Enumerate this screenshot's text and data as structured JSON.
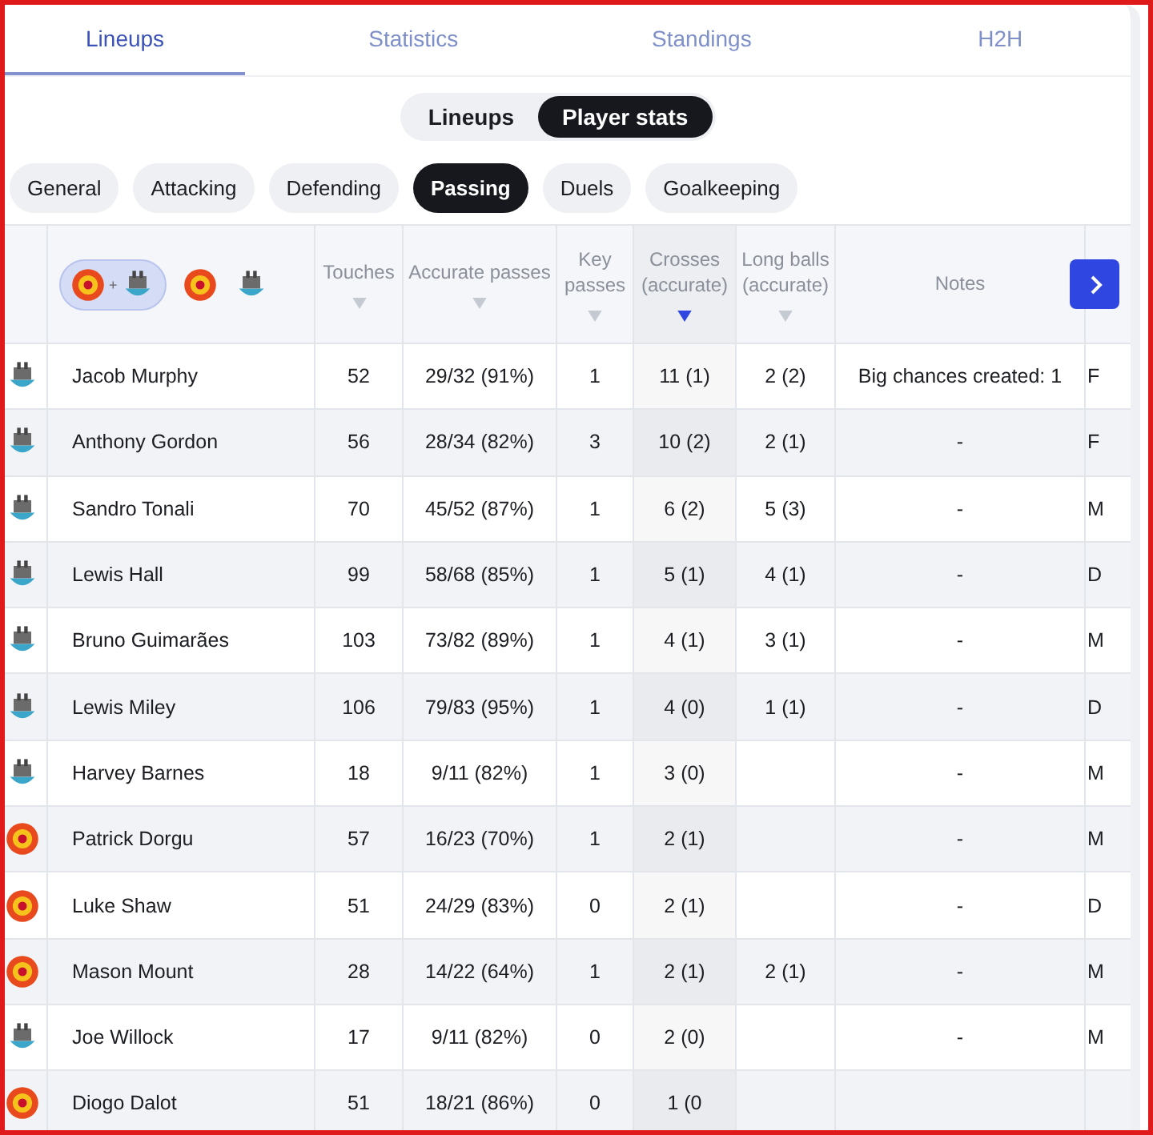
{
  "tabs": [
    {
      "label": "Lineups",
      "selected": true
    },
    {
      "label": "Statistics",
      "selected": false
    },
    {
      "label": "Standings",
      "selected": false
    },
    {
      "label": "H2H",
      "selected": false
    }
  ],
  "view_toggle": [
    {
      "label": "Lineups",
      "selected": false
    },
    {
      "label": "Player stats",
      "selected": true
    }
  ],
  "categories": [
    {
      "label": "General",
      "selected": false
    },
    {
      "label": "Attacking",
      "selected": false
    },
    {
      "label": "Defending",
      "selected": false
    },
    {
      "label": "Passing",
      "selected": true
    },
    {
      "label": "Duels",
      "selected": false
    },
    {
      "label": "Goalkeeping",
      "selected": false
    }
  ],
  "team_filter": [
    {
      "kind": "both",
      "joiner": "+",
      "selected": true
    },
    {
      "kind": "united",
      "selected": false
    },
    {
      "kind": "newcastle",
      "selected": false
    }
  ],
  "columns": [
    {
      "label": "Touches",
      "sorted": false
    },
    {
      "label": "Accurate passes",
      "sorted": false
    },
    {
      "label": "Key passes",
      "sorted": false
    },
    {
      "label": "Crosses (accurate)",
      "sorted": true
    },
    {
      "label": "Long balls (accurate)",
      "sorted": false
    },
    {
      "label": "Notes"
    }
  ],
  "rows": [
    {
      "kind": "newcastle",
      "name": "Jacob Murphy",
      "cells": [
        "52",
        "29/32 (91%)",
        "1",
        "11 (1)",
        "2 (2)",
        "Big chances created: 1"
      ],
      "position": "F"
    },
    {
      "kind": "newcastle",
      "name": "Anthony Gordon",
      "cells": [
        "56",
        "28/34 (82%)",
        "3",
        "10 (2)",
        "2 (1)",
        "-"
      ],
      "position": "F"
    },
    {
      "kind": "newcastle",
      "name": "Sandro Tonali",
      "cells": [
        "70",
        "45/52 (87%)",
        "1",
        "6 (2)",
        "5 (3)",
        "-"
      ],
      "position": "M"
    },
    {
      "kind": "newcastle",
      "name": "Lewis Hall",
      "cells": [
        "99",
        "58/68 (85%)",
        "1",
        "5 (1)",
        "4 (1)",
        "-"
      ],
      "position": "D"
    },
    {
      "kind": "newcastle",
      "name": "Bruno Guimarães",
      "cells": [
        "103",
        "73/82 (89%)",
        "1",
        "4 (1)",
        "3 (1)",
        "-"
      ],
      "position": "M"
    },
    {
      "kind": "newcastle",
      "name": "Lewis Miley",
      "cells": [
        "106",
        "79/83 (95%)",
        "1",
        "4 (0)",
        "1 (1)",
        "-"
      ],
      "position": "D"
    },
    {
      "kind": "newcastle",
      "name": "Harvey Barnes",
      "cells": [
        "18",
        "9/11 (82%)",
        "1",
        "3 (0)",
        "",
        "-"
      ],
      "position": "M"
    },
    {
      "kind": "united",
      "name": "Patrick Dorgu",
      "cells": [
        "57",
        "16/23 (70%)",
        "1",
        "2 (1)",
        "",
        "-"
      ],
      "position": "M"
    },
    {
      "kind": "united",
      "name": "Luke Shaw",
      "cells": [
        "51",
        "24/29 (83%)",
        "0",
        "2 (1)",
        "",
        "-"
      ],
      "position": "D"
    },
    {
      "kind": "united",
      "name": "Mason Mount",
      "cells": [
        "28",
        "14/22 (64%)",
        "1",
        "2 (1)",
        "2 (1)",
        "-"
      ],
      "position": "M"
    },
    {
      "kind": "newcastle",
      "name": "Joe Willock",
      "cells": [
        "17",
        "9/11 (82%)",
        "0",
        "2 (0)",
        "",
        "-"
      ],
      "position": "M"
    },
    {
      "kind": "united",
      "name": "Diogo Dalot",
      "cells": [
        "51",
        "18/21 (86%)",
        "0",
        "1 (0",
        "",
        ""
      ],
      "position": ""
    }
  ]
}
